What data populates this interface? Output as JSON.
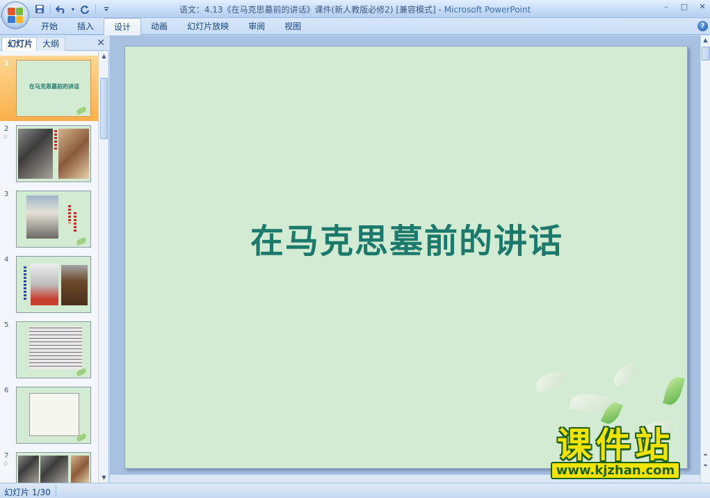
{
  "window": {
    "title_doc": "语文：4.13《在马克思墓前的讲话》课件(新人教版必修2) [兼容模式]",
    "title_sep": " - ",
    "title_app": "Microsoft PowerPoint",
    "controls": [
      "–",
      "□",
      "✕"
    ]
  },
  "ribbon": {
    "tabs": [
      {
        "label": "开始",
        "active": false
      },
      {
        "label": "插入",
        "active": false
      },
      {
        "label": "设计",
        "active": true
      },
      {
        "label": "动画",
        "active": false
      },
      {
        "label": "幻灯片放映",
        "active": false
      },
      {
        "label": "审阅",
        "active": false
      },
      {
        "label": "视图",
        "active": false
      }
    ],
    "help": "?"
  },
  "left_panel": {
    "tab_slides": "幻灯片",
    "tab_outline": "大纲",
    "close": "✕",
    "thumbnails": [
      {
        "num": "1",
        "star": "",
        "title": "在马克思墓前的讲话"
      },
      {
        "num": "2",
        "star": "☆",
        "title": ""
      },
      {
        "num": "3",
        "star": "",
        "title": ""
      },
      {
        "num": "4",
        "star": "",
        "title": ""
      },
      {
        "num": "5",
        "star": "",
        "title": ""
      },
      {
        "num": "6",
        "star": "",
        "title": ""
      },
      {
        "num": "7",
        "star": "☆",
        "title": ""
      }
    ]
  },
  "slide": {
    "title": "在马克思墓前的讲话",
    "background": "#d3ebd3",
    "title_color": "#1b7a6c"
  },
  "watermark": {
    "big": "课件站",
    "url": "www.kjzhan.com"
  },
  "status": {
    "slide_counter": "幻灯片 1/30"
  },
  "icons": {
    "save": "save-icon",
    "undo": "undo-icon",
    "redo": "redo-icon",
    "customize": "customize-qat-icon"
  }
}
